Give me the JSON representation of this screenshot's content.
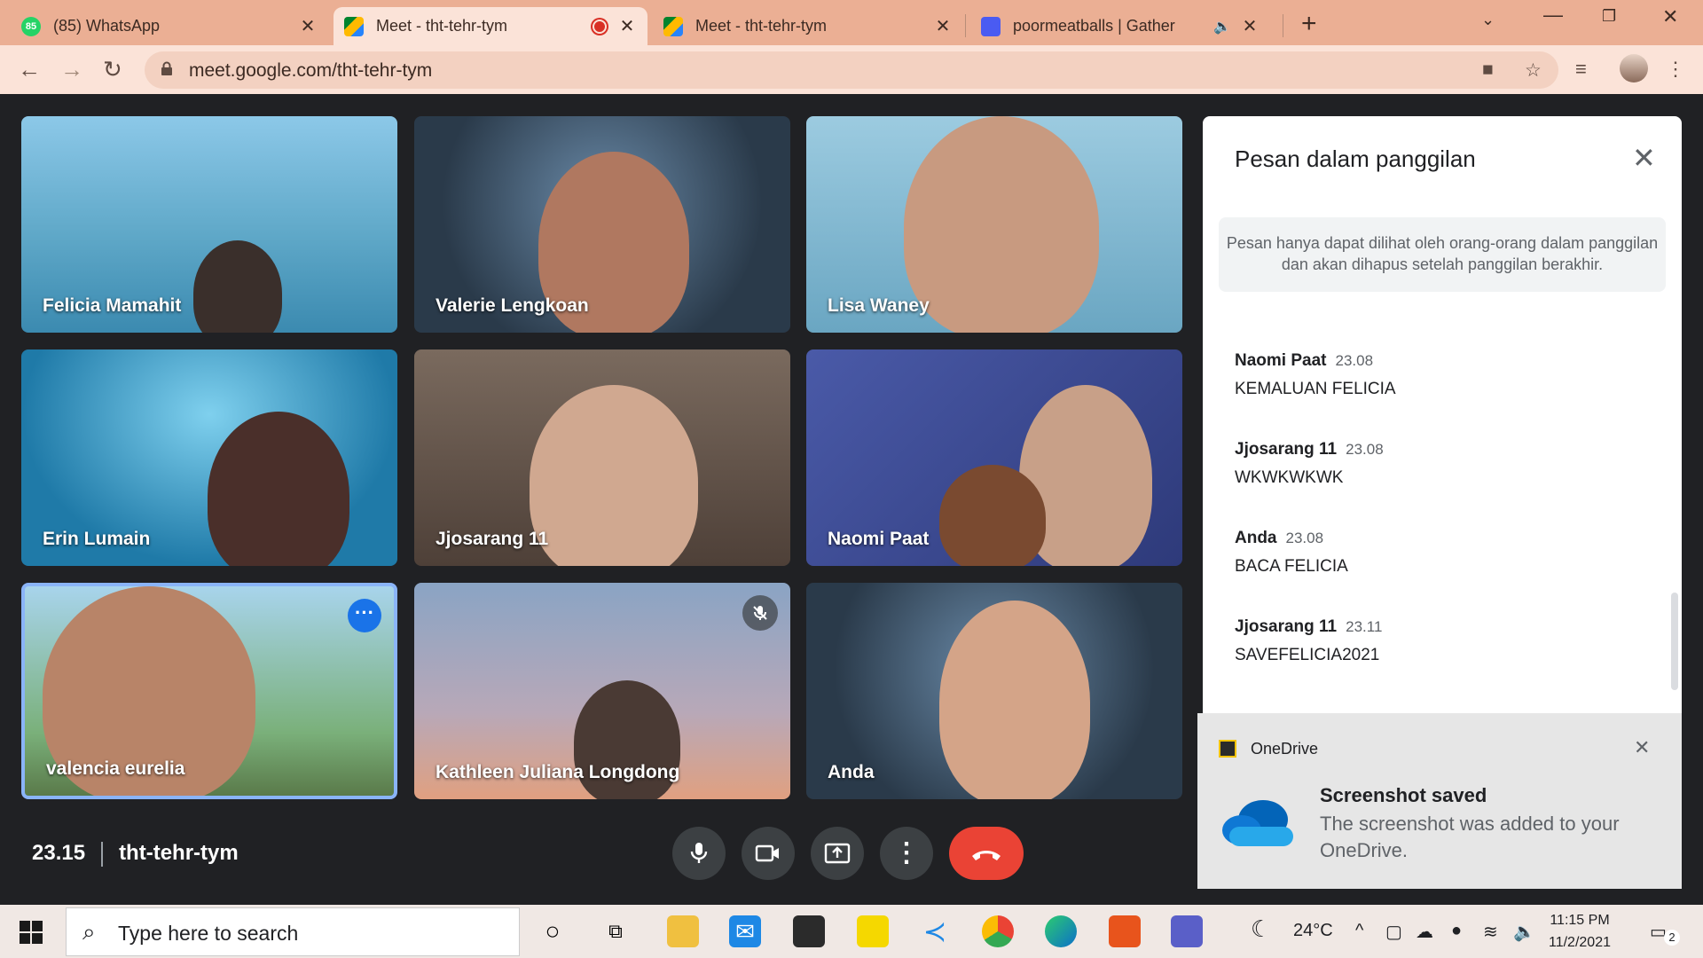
{
  "browser": {
    "tabs": [
      {
        "label": "(85) WhatsApp",
        "badge": "85",
        "icon": "whatsapp-icon"
      },
      {
        "label": "Meet - tht-tehr-tym",
        "icon": "meet-icon",
        "recording": true
      },
      {
        "label": "Meet - tht-tehr-tym",
        "icon": "meet-icon"
      },
      {
        "label": "poormeatballs | Gather",
        "icon": "gather-icon",
        "audio": true
      }
    ],
    "close_glyph": "✕",
    "new_tab_glyph": "+",
    "url": "meet.google.com/tht-tehr-tym"
  },
  "participants": [
    {
      "name": "Felicia Mamahit",
      "bg": "#6fa8c8"
    },
    {
      "name": "Valerie Lengkoan",
      "bg": "#4a5a6a"
    },
    {
      "name": "Lisa Waney",
      "bg": "#7ab0c8"
    },
    {
      "name": "Erin Lumain",
      "bg": "#2f8fb8"
    },
    {
      "name": "Jjosarang 11",
      "bg": "#6e5c52"
    },
    {
      "name": "Naomi Paat",
      "bg": "#3e4e9a"
    },
    {
      "name": "valencia eurelia",
      "bg": "#6a9c6a"
    },
    {
      "name": "Kathleen Juliana Longdong",
      "bg": "#8fa1b8"
    },
    {
      "name": "Anda",
      "bg": "#3e4a5c"
    }
  ],
  "meeting": {
    "time": "23.15",
    "code": "tht-tehr-tym"
  },
  "chat": {
    "title": "Pesan dalam panggilan",
    "notice": "Pesan hanya dapat dilihat oleh orang-orang dalam panggilan dan akan dihapus setelah panggilan berakhir.",
    "messages": [
      {
        "sender": "Naomi Paat",
        "time": "23.08",
        "text": "KEMALUAN FELICIA"
      },
      {
        "sender": "Jjosarang 11",
        "time": "23.08",
        "text": "WKWKWKWK"
      },
      {
        "sender": "Anda",
        "time": "23.08",
        "text": "BACA FELICIA"
      },
      {
        "sender": "Jjosarang 11",
        "time": "23.11",
        "text": "SAVEFELICIA2021"
      }
    ]
  },
  "toast": {
    "app": "OneDrive",
    "title": "Screenshot saved",
    "body": "The screenshot was added to your OneDrive."
  },
  "taskbar": {
    "search_placeholder": "Type here to search",
    "weather": "24°C",
    "time": "11:15 PM",
    "date": "11/2/2021",
    "notification_count": "2"
  }
}
